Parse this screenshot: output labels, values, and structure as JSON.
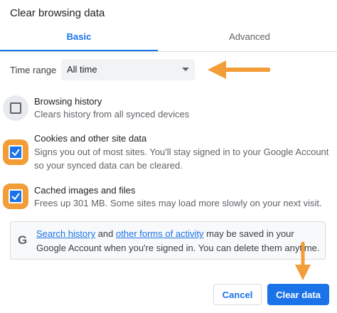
{
  "dialog": {
    "title": "Clear browsing data"
  },
  "tabs": [
    {
      "label": "Basic",
      "active": true
    },
    {
      "label": "Advanced",
      "active": false
    }
  ],
  "time_range": {
    "label": "Time range",
    "value": "All time"
  },
  "options": [
    {
      "title": "Browsing history",
      "description": "Clears history from all synced devices",
      "checked": false,
      "highlight": "none"
    },
    {
      "title": "Cookies and other site data",
      "description": "Signs you out of most sites. You'll stay signed in to your Google Account so your synced data can be cleared.",
      "checked": true,
      "highlight": "orange"
    },
    {
      "title": "Cached images and files",
      "description": "Frees up 301 MB. Some sites may load more slowly on your next visit.",
      "checked": true,
      "highlight": "orange"
    }
  ],
  "info": {
    "logo": "G",
    "link1": "Search history",
    "text1": " and ",
    "link2": "other forms of activity",
    "text2": " may be saved in your Google Account when you're signed in. You can delete them anytime."
  },
  "buttons": {
    "cancel": "Cancel",
    "clear": "Clear data"
  },
  "colors": {
    "accent": "#1a73e8",
    "annotation_arrow": "#f29d38"
  },
  "icons": {
    "select_caret": "chevron-down-icon",
    "checkbox": "checkmark-icon",
    "google": "google-g-icon"
  }
}
